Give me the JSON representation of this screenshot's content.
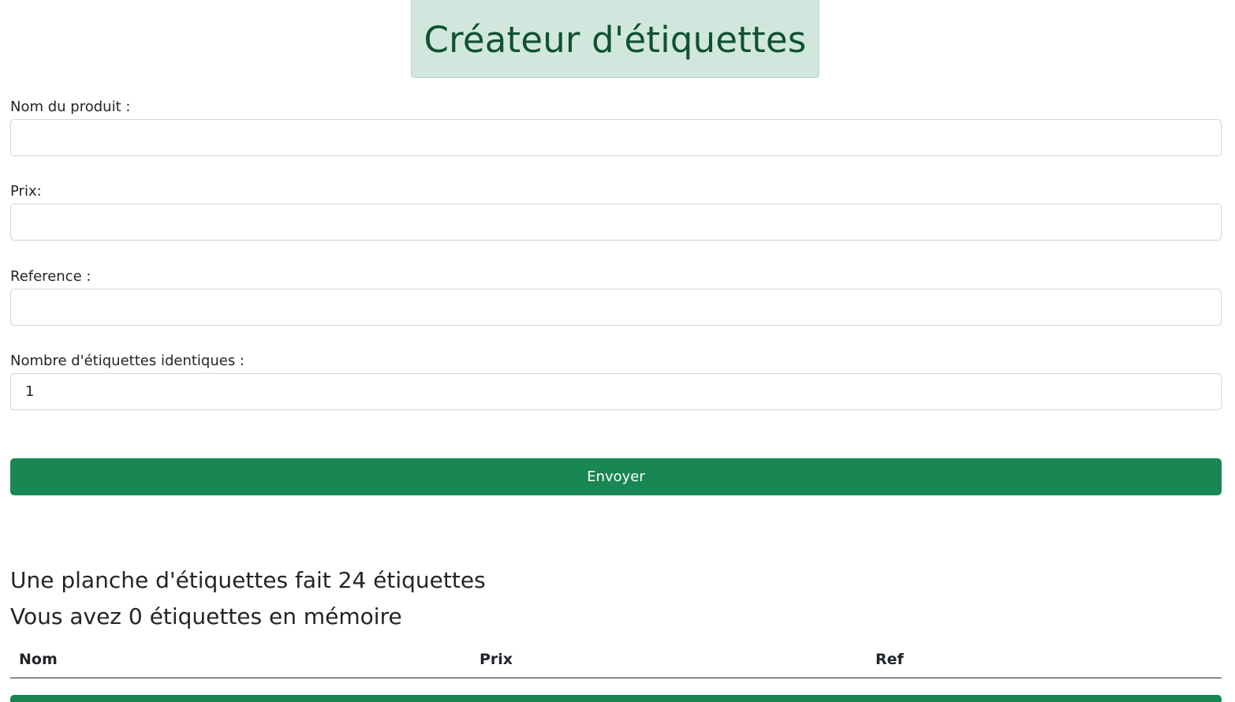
{
  "header": {
    "title": "Créateur d'étiquettes"
  },
  "form": {
    "product_name": {
      "label": "Nom du produit :",
      "value": ""
    },
    "price": {
      "label": "Prix:",
      "value": ""
    },
    "reference": {
      "label": "Reference :",
      "value": ""
    },
    "quantity": {
      "label": "Nombre d'étiquettes identiques :",
      "value": "1"
    },
    "submit_label": "Envoyer"
  },
  "info": {
    "sheet_line": "Une planche d'étiquettes fait 24 étiquettes",
    "memory_line": "Vous avez 0 étiquettes en mémoire"
  },
  "table": {
    "headers": [
      "Nom",
      "Prix",
      "Ref"
    ],
    "rows": []
  },
  "colors": {
    "accent": "#198754",
    "title_bg": "#d1e7dd",
    "title_text": "#0f5132"
  }
}
